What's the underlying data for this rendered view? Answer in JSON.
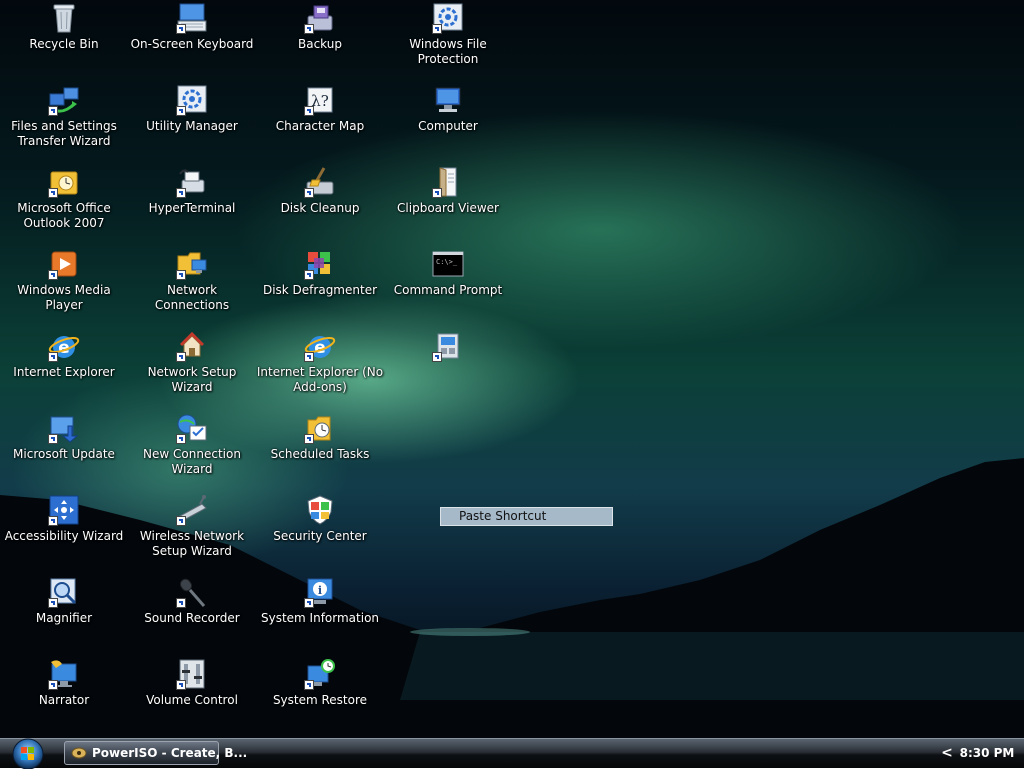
{
  "desktop": {
    "icons": [
      {
        "label": "Recycle Bin",
        "icon": "recycle-bin-icon"
      },
      {
        "label": "On-Screen Keyboard",
        "icon": "keyboard-icon"
      },
      {
        "label": "Backup",
        "icon": "backup-icon"
      },
      {
        "label": "Windows File Protection",
        "icon": "file-protection-icon"
      },
      {
        "label": "Files and Settings Transfer Wizard",
        "icon": "transfer-wizard-icon"
      },
      {
        "label": "Utility Manager",
        "icon": "utility-manager-icon"
      },
      {
        "label": "Character Map",
        "icon": "character-map-icon"
      },
      {
        "label": "Computer",
        "icon": "computer-icon"
      },
      {
        "label": "Microsoft Office Outlook 2007",
        "icon": "outlook-icon"
      },
      {
        "label": "HyperTerminal",
        "icon": "hyperterminal-icon"
      },
      {
        "label": "Disk Cleanup",
        "icon": "disk-cleanup-icon"
      },
      {
        "label": "Clipboard Viewer",
        "icon": "clipboard-viewer-icon"
      },
      {
        "label": "Windows Media Player",
        "icon": "media-player-icon"
      },
      {
        "label": "Network Connections",
        "icon": "network-connections-icon"
      },
      {
        "label": "Disk Defragmenter",
        "icon": "disk-defragmenter-icon"
      },
      {
        "label": "Command Prompt",
        "icon": "command-prompt-icon"
      },
      {
        "label": "Internet Explorer",
        "icon": "internet-explorer-icon"
      },
      {
        "label": "Network Setup Wizard",
        "icon": "network-setup-wizard-icon"
      },
      {
        "label": "Internet Explorer (No Add-ons)",
        "icon": "internet-explorer-no-addons-icon"
      },
      {
        "label": "",
        "icon": "unnamed-shortcut-icon"
      },
      {
        "label": "Microsoft Update",
        "icon": "microsoft-update-icon"
      },
      {
        "label": "New Connection Wizard",
        "icon": "new-connection-wizard-icon"
      },
      {
        "label": "Scheduled Tasks",
        "icon": "scheduled-tasks-icon"
      },
      {
        "label": "Accessibility Wizard",
        "icon": "accessibility-wizard-icon"
      },
      {
        "label": "Wireless Network Setup Wizard",
        "icon": "wireless-setup-wizard-icon"
      },
      {
        "label": "Security Center",
        "icon": "security-center-icon"
      },
      {
        "label": "Magnifier",
        "icon": "magnifier-icon"
      },
      {
        "label": "Sound Recorder",
        "icon": "sound-recorder-icon"
      },
      {
        "label": "System Information",
        "icon": "system-information-icon"
      },
      {
        "label": "Narrator",
        "icon": "narrator-icon"
      },
      {
        "label": "Volume Control",
        "icon": "volume-control-icon"
      },
      {
        "label": "System Restore",
        "icon": "system-restore-icon"
      }
    ],
    "context_item": "Paste Shortcut"
  },
  "taskbar": {
    "start_icon": "windows-orb-icon",
    "running_app": "PowerISO - Create, B...",
    "running_app_icon": "poweriso-icon",
    "tray_expand": "<",
    "clock": "8:30 PM"
  }
}
